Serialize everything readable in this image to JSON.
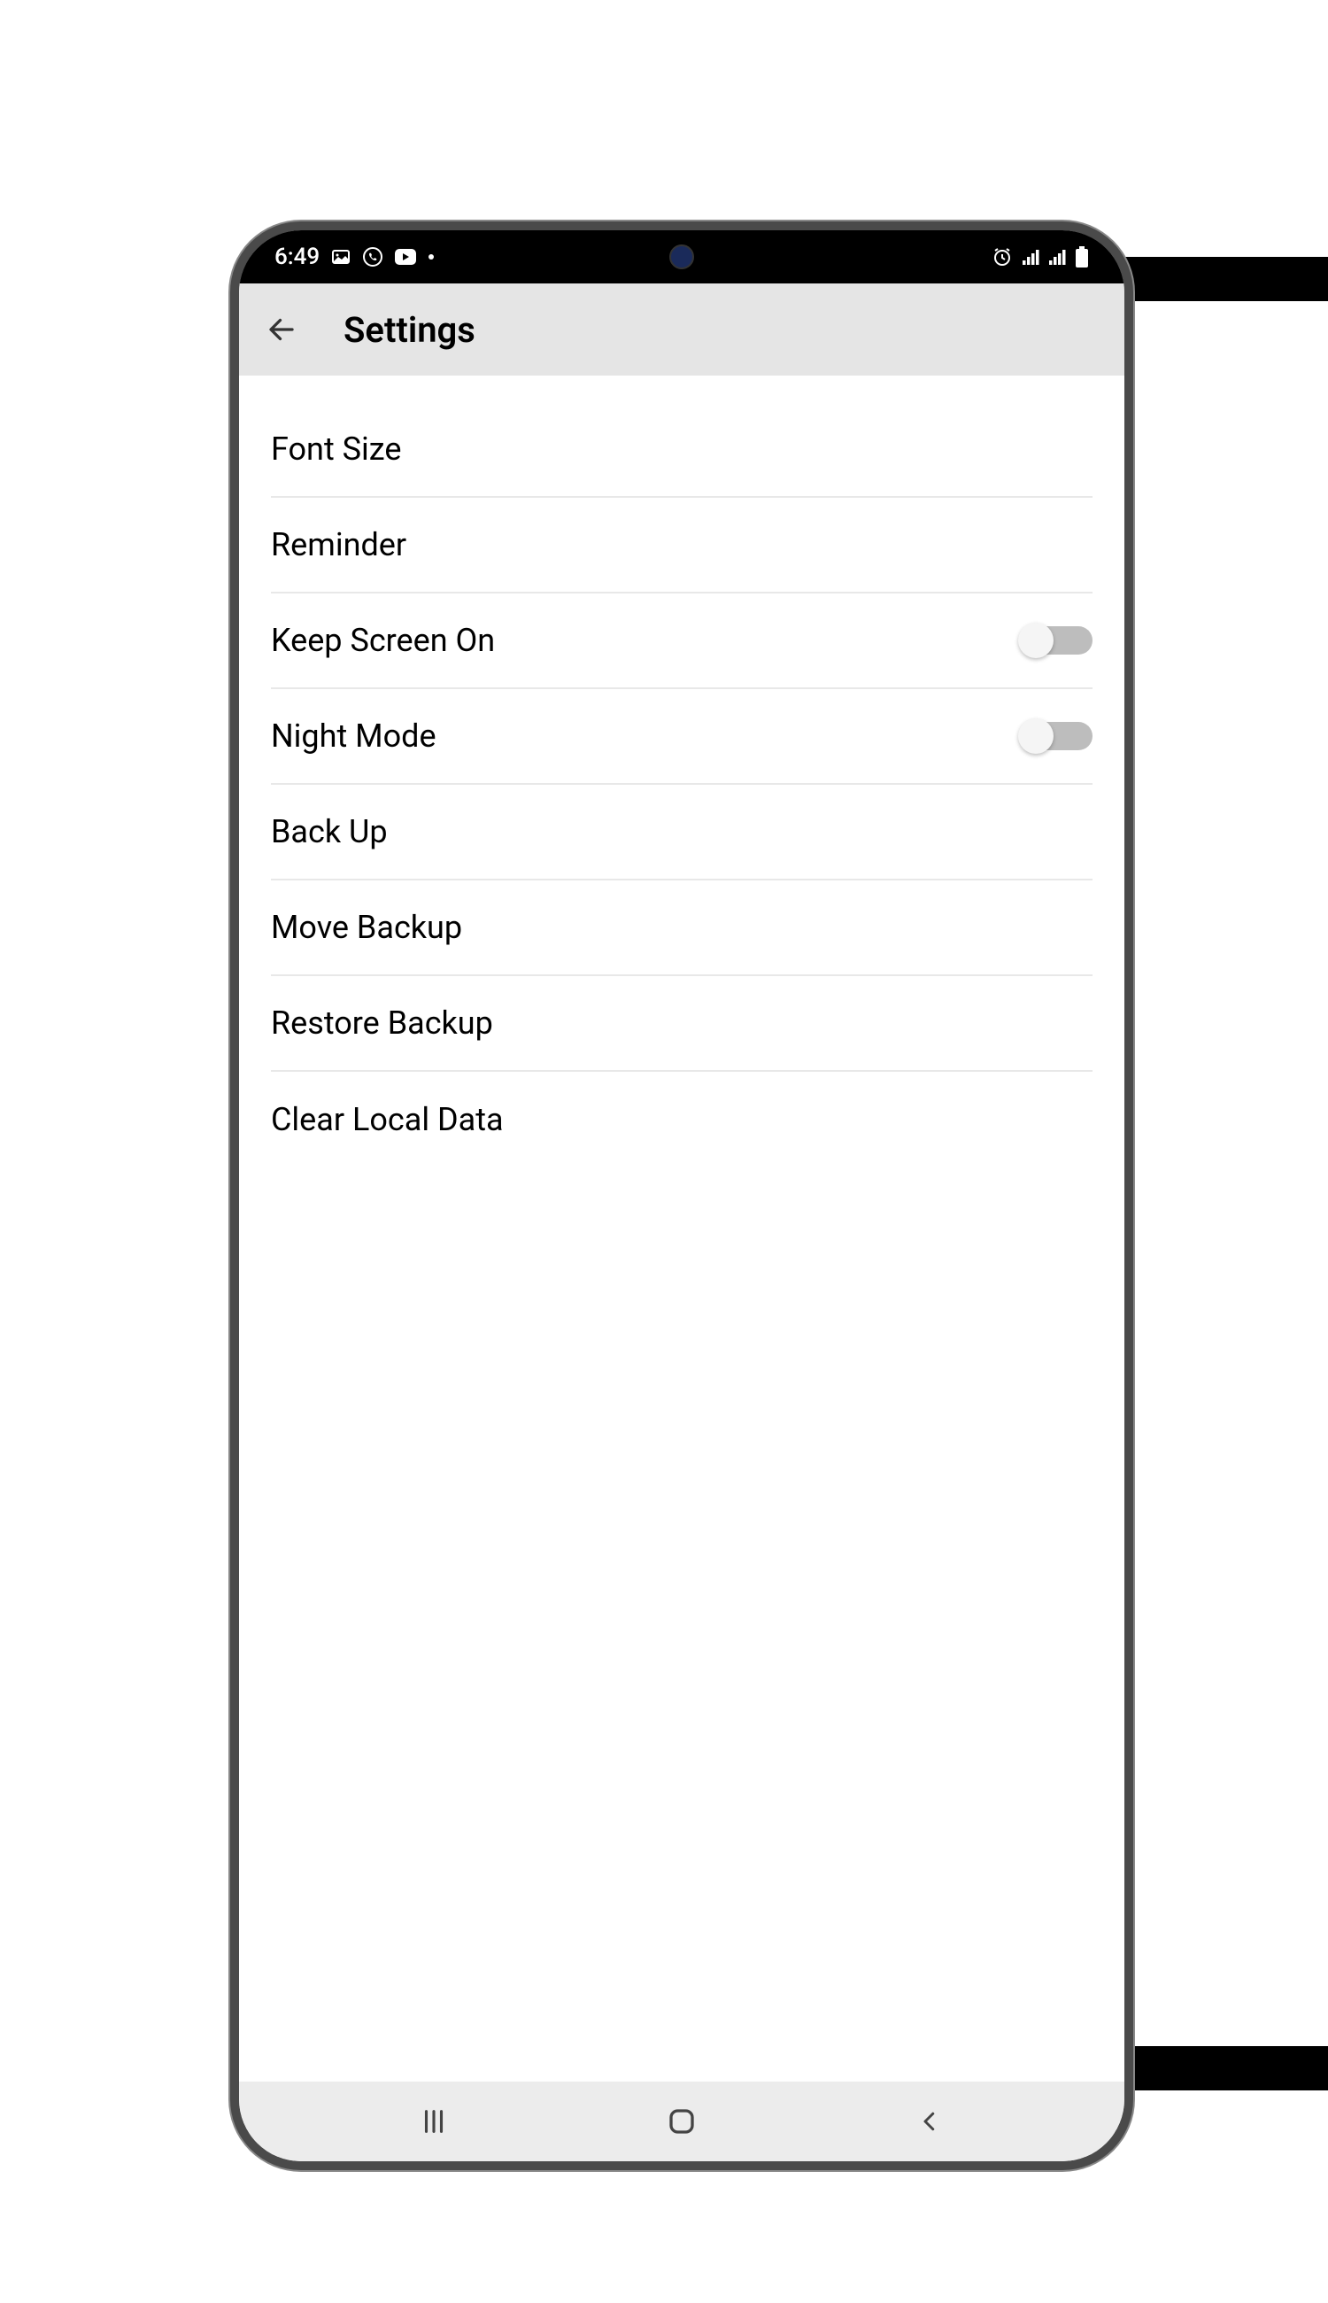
{
  "status_bar": {
    "time": "6:49",
    "left_icons": [
      "image-icon",
      "whatsapp-icon",
      "youtube-icon",
      "dot-icon"
    ],
    "right_icons": [
      "alarm-icon",
      "signal-1-icon",
      "signal-2-icon",
      "battery-icon"
    ]
  },
  "app_bar": {
    "title": "Settings"
  },
  "settings": {
    "items": [
      {
        "label": "Font Size",
        "type": "link"
      },
      {
        "label": "Reminder",
        "type": "link"
      },
      {
        "label": "Keep Screen On",
        "type": "toggle",
        "value": false
      },
      {
        "label": "Night Mode",
        "type": "toggle",
        "value": false
      },
      {
        "label": "Back Up",
        "type": "link"
      },
      {
        "label": "Move Backup",
        "type": "link"
      },
      {
        "label": "Restore Backup",
        "type": "link"
      },
      {
        "label": "Clear Local Data",
        "type": "link"
      }
    ]
  },
  "nav_bar": {
    "buttons": [
      "recent",
      "home",
      "back"
    ]
  }
}
